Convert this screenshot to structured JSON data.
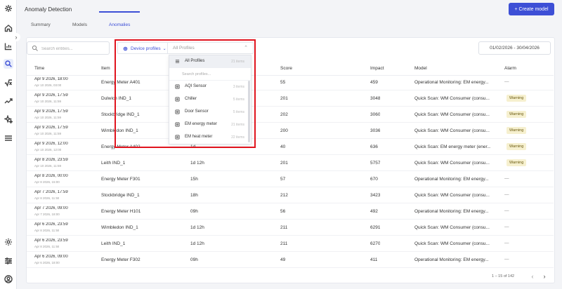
{
  "header": {
    "title": "Anomaly Detection",
    "create_label": "+ Create model"
  },
  "tabs": [
    {
      "label": "Summary"
    },
    {
      "label": "Models"
    },
    {
      "label": "Anomalies"
    }
  ],
  "search": {
    "placeholder": "Search entities..."
  },
  "filter": {
    "label": "Device profiles",
    "value_placeholder": "All Profiles",
    "menu_search_placeholder": "Search profiles...",
    "items": [
      {
        "label": "All Profiles",
        "count": "21 items"
      },
      {
        "label": "AQI Sensor",
        "count": "3 items"
      },
      {
        "label": "Chiller",
        "count": "5 items"
      },
      {
        "label": "Door Sensor",
        "count": "5 items"
      },
      {
        "label": "EM energy meter",
        "count": "21 items"
      },
      {
        "label": "EM heat meter",
        "count": "22 items"
      }
    ]
  },
  "date_range": "01/02/2026 - 30/04/2026",
  "table": {
    "columns": [
      "Time",
      "Item",
      "",
      "Score",
      "Impact",
      "Model",
      "Alarm"
    ],
    "rows": [
      {
        "time": "Apr 9 2026, 18:00",
        "time_sub": "Apr 10 2026, 03:00",
        "item": "Energy Meter A401",
        "duration": "",
        "score": "55",
        "impact": "459",
        "model": "Operational Monitoring: EM energy...",
        "alarm": "—"
      },
      {
        "time": "Apr 9 2026, 17:59",
        "time_sub": "Apr 10 2026, 11:59",
        "item": "Dulwich IND_1",
        "duration": "",
        "score": "201",
        "impact": "3048",
        "model": "Quick Scan: WM Consumer (consu...",
        "alarm": "Warning"
      },
      {
        "time": "Apr 9 2026, 17:59",
        "time_sub": "Apr 10 2026, 11:59",
        "item": "Stockbridge IND_1",
        "duration": "",
        "score": "202",
        "impact": "3060",
        "model": "Quick Scan: WM Consumer (consu...",
        "alarm": "Warning"
      },
      {
        "time": "Apr 9 2026, 17:59",
        "time_sub": "Apr 10 2026, 11:59",
        "item": "Wimbledon IND_1",
        "duration": "",
        "score": "200",
        "impact": "3036",
        "model": "Quick Scan: WM Consumer (consu...",
        "alarm": "Warning"
      },
      {
        "time": "Apr 9 2026, 12:00",
        "time_sub": "Apr 10 2026, 12:00",
        "item": "Energy Meter A402",
        "duration": "1d",
        "score": "40",
        "impact": "636",
        "model": "Quick Scan: EM energy meter (ener...",
        "alarm": "Warning"
      },
      {
        "time": "Apr 8 2026, 23:59",
        "time_sub": "Apr 10 2026, 11:59",
        "item": "Leith IND_1",
        "duration": "1d 12h",
        "score": "201",
        "impact": "5757",
        "model": "Quick Scan: WM Consumer (consu...",
        "alarm": "Warning"
      },
      {
        "time": "Apr 8 2026, 00:00",
        "time_sub": "Apr 8 2026, 15:00",
        "item": "Energy Meter F301",
        "duration": "15h",
        "score": "57",
        "impact": "670",
        "model": "Operational Monitoring: EM energy...",
        "alarm": "—"
      },
      {
        "time": "Apr 7 2026, 17:59",
        "time_sub": "Apr 8 2026, 11:59",
        "item": "Stockbridge IND_1",
        "duration": "18h",
        "score": "212",
        "impact": "3423",
        "model": "Quick Scan: WM Consumer (consu...",
        "alarm": "—"
      },
      {
        "time": "Apr 7 2026, 09:00",
        "time_sub": "Apr 7 2026, 18:00",
        "item": "Energy Meter H101",
        "duration": "09h",
        "score": "56",
        "impact": "492",
        "model": "Operational Monitoring: EM energy...",
        "alarm": "—"
      },
      {
        "time": "Apr 6 2026, 23:59",
        "time_sub": "Apr 8 2026, 11:59",
        "item": "Wimbledon IND_1",
        "duration": "1d 12h",
        "score": "211",
        "impact": "6291",
        "model": "Quick Scan: WM Consumer (consu...",
        "alarm": "—"
      },
      {
        "time": "Apr 6 2026, 23:59",
        "time_sub": "Apr 8 2026, 11:59",
        "item": "Leith IND_1",
        "duration": "1d 12h",
        "score": "211",
        "impact": "6270",
        "model": "Quick Scan: WM Consumer (consu...",
        "alarm": "—"
      },
      {
        "time": "Apr 6 2026, 09:00",
        "time_sub": "Apr 6 2026, 18:00",
        "item": "Energy Meter F302",
        "duration": "09h",
        "score": "49",
        "impact": "411",
        "model": "Operational Monitoring: EM energy...",
        "alarm": "—"
      }
    ]
  },
  "pagination": {
    "text": "1 – 15 of 142"
  },
  "icons": [
    "app-logo-icon",
    "home-icon",
    "chart-icon",
    "search-icon",
    "sqrt-icon",
    "trend-icon",
    "sparkle-icon",
    "menu-icon",
    "settings-icon",
    "sliders-icon",
    "user-icon"
  ],
  "colors": {
    "accent": "#3d4fd6",
    "warning_bg": "#f6f0cf",
    "highlight": "#e0141e"
  }
}
